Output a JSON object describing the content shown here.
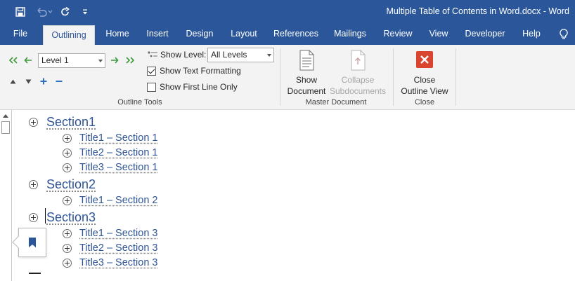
{
  "window": {
    "title": "Multiple Table of Contents in Word.docx  -  Word"
  },
  "quick_access": {
    "save_icon": "save-icon",
    "undo_icon": "undo-icon",
    "redo_icon": "redo-icon",
    "customize_icon": "customize-qat-icon"
  },
  "tabs": [
    {
      "label": "File"
    },
    {
      "label": "Outlining"
    },
    {
      "label": "Home"
    },
    {
      "label": "Insert"
    },
    {
      "label": "Design"
    },
    {
      "label": "Layout"
    },
    {
      "label": "References"
    },
    {
      "label": "Mailings"
    },
    {
      "label": "Review"
    },
    {
      "label": "View"
    },
    {
      "label": "Developer"
    },
    {
      "label": "Help"
    }
  ],
  "tell_me_icon": "lightbulb-icon",
  "outline_tools": {
    "group_label": "Outline Tools",
    "level_select": "Level 1",
    "show_level_label": "Show Level:",
    "show_level_value": "All Levels",
    "show_text_formatting_label": "Show Text Formatting",
    "show_text_formatting_checked": true,
    "show_first_line_label": "Show First Line Only",
    "show_first_line_checked": false,
    "colors": {
      "arrow_green": "#3a9a3a",
      "arrow_blue": "#2e6fbf"
    }
  },
  "master_document": {
    "group_label": "Master Document",
    "show_document_line1": "Show",
    "show_document_line2": "Document",
    "collapse_line1": "Collapse",
    "collapse_line2": "Subdocuments"
  },
  "close_group": {
    "group_label": "Close",
    "close_line1": "Close",
    "close_line2": "Outline View",
    "close_color": "#d9452f"
  },
  "outline": [
    {
      "level": 1,
      "text": "Section1"
    },
    {
      "level": 2,
      "text": "Title1 – Section 1"
    },
    {
      "level": 2,
      "text": "Title2 – Section 1"
    },
    {
      "level": 2,
      "text": "Title3 – Section 1"
    },
    {
      "level": 1,
      "text": "Section2"
    },
    {
      "level": 2,
      "text": "Title1 – Section 2"
    },
    {
      "level": 1,
      "text": "Section3"
    },
    {
      "level": 2,
      "text": "Title1 – Section 3"
    },
    {
      "level": 2,
      "text": "Title2 – Section 3"
    },
    {
      "level": 2,
      "text": "Title3 – Section 3"
    }
  ],
  "bookmark_icon": "bookmark-icon"
}
